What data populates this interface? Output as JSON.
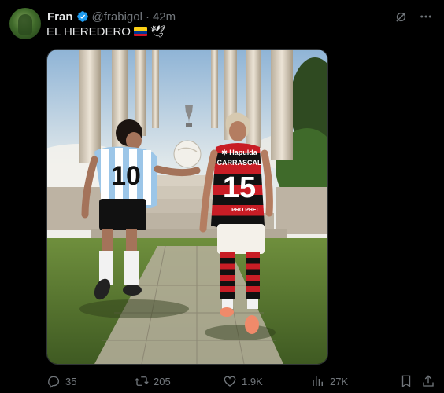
{
  "tweet": {
    "author_name": "Fran",
    "handle": "@frabigol",
    "separator": "·",
    "time": "42m",
    "text": "EL HEREDERO",
    "emoji_dove": "🕊"
  },
  "media": {
    "left_jersey_number": "10",
    "right_jersey_number": "15",
    "right_jersey_name": "CARRASCAL",
    "right_jersey_sponsor": "✲ Hapulda",
    "right_jersey_sponsor2": "PRO PHEL"
  },
  "actions": {
    "replies": "35",
    "reposts": "205",
    "likes": "1.9K",
    "views": "27K"
  },
  "colors": {
    "background": "#000000",
    "text_primary": "#e7e9ea",
    "text_secondary": "#71767b",
    "verified": "#1d9bf0"
  }
}
